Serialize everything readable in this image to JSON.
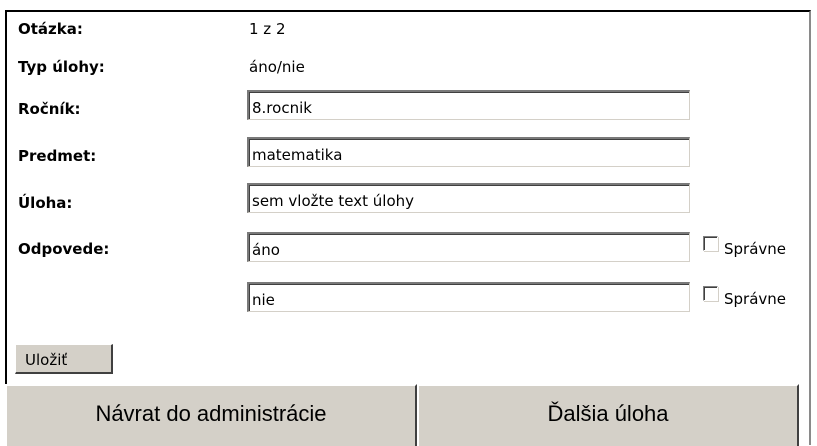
{
  "form": {
    "question_label": "Otázka:",
    "question_value": "1 z 2",
    "type_label": "Typ úlohy:",
    "type_value": "áno/nie",
    "grade_label": "Ročník:",
    "grade_value": "8.rocnik",
    "subject_label": "Predmet:",
    "subject_value": "matematika",
    "task_label": "Úloha:",
    "task_value": "sem vložte text úlohy",
    "answers_label": "Odpovede:",
    "answers": [
      {
        "value": "áno",
        "correct_label": "Správne",
        "checked": false
      },
      {
        "value": "nie",
        "correct_label": "Správne",
        "checked": false
      }
    ],
    "save_label": "Uložiť"
  },
  "footer": {
    "back_label": "Návrat do administrácie",
    "next_label": "Ďalšia úloha"
  }
}
